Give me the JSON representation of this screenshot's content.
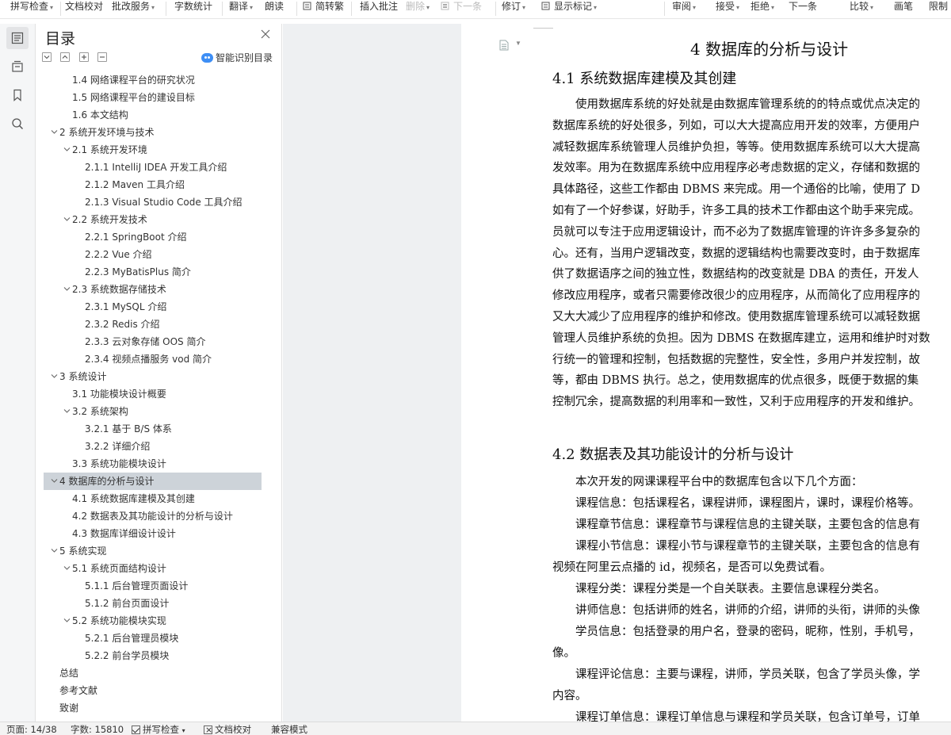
{
  "ribbon": {
    "left": [
      {
        "label": "拼写检查",
        "dd": true
      },
      {
        "label": "文档校对",
        "dd": false
      },
      {
        "label": "批改服务",
        "dd": true
      },
      {
        "label": "字数统计",
        "dd": false
      },
      {
        "label": "翻译",
        "dd": true
      },
      {
        "label": "朗读",
        "dd": false
      },
      {
        "label": "简转繁",
        "dd": false
      },
      {
        "label": "插入批注",
        "dd": false
      },
      {
        "label": "删除",
        "dd": true
      },
      {
        "label": "下一条",
        "dd": false
      },
      {
        "label": "修订",
        "dd": true
      },
      {
        "label": "显示标记",
        "dd": true
      }
    ],
    "right": [
      {
        "label": "审阅",
        "dd": true
      },
      {
        "label": "接受",
        "dd": true
      },
      {
        "label": "拒绝",
        "dd": true
      },
      {
        "label": "下一条",
        "dd": false
      },
      {
        "label": "比较",
        "dd": true
      },
      {
        "label": "画笔",
        "dd": false
      },
      {
        "label": "限制",
        "dd": false
      }
    ]
  },
  "rail": {
    "icons": [
      "outline-icon",
      "sections-icon",
      "bookmark-icon",
      "search-icon"
    ]
  },
  "outline": {
    "title": "目录",
    "smart_label": "智能识别目录",
    "items": [
      {
        "label": "1.4  网络课程平台的研究状况",
        "level": 2,
        "chev": false
      },
      {
        "label": "1.5  网络课程平台的建设目标",
        "level": 2,
        "chev": false
      },
      {
        "label": "1.6  本文结构",
        "level": 2,
        "chev": false
      },
      {
        "label": "2  系统开发环境与技术",
        "level": 1,
        "chev": true
      },
      {
        "label": "2.1  系统开发环境",
        "level": 2,
        "chev": true
      },
      {
        "label": "2.1.1 IntelliJ IDEA  开发工具介绍",
        "level": 3,
        "chev": false
      },
      {
        "label": "2.1.2 Maven 工具介绍",
        "level": 3,
        "chev": false
      },
      {
        "label": "2.1.3 Visual Studio Code 工具介绍",
        "level": 3,
        "chev": false
      },
      {
        "label": "2.2  系统开发技术",
        "level": 2,
        "chev": true
      },
      {
        "label": "2.2.1 SpringBoot 介绍",
        "level": 3,
        "chev": false
      },
      {
        "label": "2.2.2 Vue 介绍",
        "level": 3,
        "chev": false
      },
      {
        "label": "2.2.3 MyBatisPlus 简介",
        "level": 3,
        "chev": false
      },
      {
        "label": "2.3  系统数据存储技术",
        "level": 2,
        "chev": true
      },
      {
        "label": "2.3.1 MySQL 介绍",
        "level": 3,
        "chev": false
      },
      {
        "label": "2.3.2 Redis 介绍",
        "level": 3,
        "chev": false
      },
      {
        "label": "2.3.3  云对象存储 OOS 简介",
        "level": 3,
        "chev": false
      },
      {
        "label": "2.3.4  视频点播服务 vod 简介",
        "level": 3,
        "chev": false
      },
      {
        "label": "3  系统设计",
        "level": 1,
        "chev": true
      },
      {
        "label": "3.1  功能模块设计概要",
        "level": 2,
        "chev": false
      },
      {
        "label": "3.2  系统架构",
        "level": 2,
        "chev": true
      },
      {
        "label": "3.2.1  基于 B/S 体系",
        "level": 3,
        "chev": false
      },
      {
        "label": "3.2.2  详细介绍",
        "level": 3,
        "chev": false
      },
      {
        "label": "3.3  系统功能模块设计",
        "level": 2,
        "chev": false
      },
      {
        "label": "4  数据库的分析与设计",
        "level": 1,
        "chev": true,
        "selected": true
      },
      {
        "label": "4.1  系统数据库建模及其创建",
        "level": 2,
        "chev": false
      },
      {
        "label": "4.2  数据表及其功能设计的分析与设计",
        "level": 2,
        "chev": false
      },
      {
        "label": "4.3  数据库详细设计设计",
        "level": 2,
        "chev": false
      },
      {
        "label": "5  系统实现",
        "level": 1,
        "chev": true
      },
      {
        "label": "5.1  系统页面结构设计",
        "level": 2,
        "chev": true
      },
      {
        "label": "5.1.1  后台管理页面设计",
        "level": 3,
        "chev": false
      },
      {
        "label": "5.1.2 前台页面设计",
        "level": 3,
        "chev": false
      },
      {
        "label": "5.2  系统功能模块实现",
        "level": 2,
        "chev": true
      },
      {
        "label": "5.2.1  后台管理员模块",
        "level": 3,
        "chev": false
      },
      {
        "label": "5.2.2  前台学员模块",
        "level": 3,
        "chev": false
      },
      {
        "label": "总结",
        "level": 1,
        "chev": false
      },
      {
        "label": "参考文献",
        "level": 1,
        "chev": false
      },
      {
        "label": "致谢",
        "level": 1,
        "chev": false
      }
    ]
  },
  "document": {
    "h1": "4  数据库的分析与设计",
    "h2_1": "4.1  系统数据库建模及其创建",
    "para1": [
      "　　使用数据库系统的好处就是由数据库管理系统的的特点或优点决定的",
      "数据库系统的好处很多，列如，可以大大提高应用开发的效率，方便用户",
      "减轻数据库系统管理人员维护负担，等等。使用数据库系统可以大大提高",
      "发效率。用为在数据库系统中应用程序必考虑数据的定义，存储和数据的",
      "具体路径，这些工作都由 DBMS 来完成。用一个通俗的比喻，使用了 D",
      "如有了一个好参谋，好助手，许多工具的技术工作都由这个助手来完成。",
      "员就可以专注于应用逻辑设计，而不必为了数据库管理的许许多多复杂的",
      "心。还有，当用户逻辑改变，数据的逻辑结构也需要改变时，由于数据库",
      "供了数据语序之间的独立性，数据结构的改变就是 DBA 的责任，开发人",
      "修改应用程序，或者只需要修改很少的应用程序，从而简化了应用程序的",
      "又大大减少了应用程序的维护和修改。使用数据库管理系统可以减轻数据",
      "管理人员维护系统的负担。因为 DBMS 在数据库建立，运用和维护时对数",
      "行统一的管理和控制，包括数据的完整性，安全性，多用户并发控制，故",
      "等，都由 DBMS 执行。总之，使用数据库的优点很多，既便于数据的集",
      "控制冗余，提高数据的利用率和一致性，又利于应用程序的开发和维护。"
    ],
    "h2_2": "4.2  数据表及其功能设计的分析与设计",
    "para2": [
      "　　本次开发的网课课程平台中的数据库包含以下几个方面：",
      "　　课程信息：包括课程名，课程讲师，课程图片，课时，课程价格等。",
      "　　课程章节信息：课程章节与课程信息的主键关联，主要包含的信息有",
      "　　课程小节信息：课程小节与课程章节的主键关联，主要包含的信息有",
      "视频在阿里云点播的 id，视频名，是否可以免费试看。",
      "　　课程分类：课程分类是一个自关联表。主要信息课程分类名。",
      "　　讲师信息：包括讲师的姓名，讲师的介绍，讲师的头衔，讲师的头像",
      "　　学员信息：包括登录的用户名，登录的密码，昵称，性别，手机号，",
      "像。",
      "　　课程评论信息：主要与课程，讲师，学员关联，包含了学员头像，学",
      "内容。",
      "　　课程订单信息：课程订单信息与课程和学员关联，包含订单号，订单"
    ]
  },
  "status": {
    "page": "页面: 14/38",
    "words": "字数: 15810",
    "spell": "拼写检查",
    "proof": "文档校对",
    "compat": "兼容模式"
  }
}
